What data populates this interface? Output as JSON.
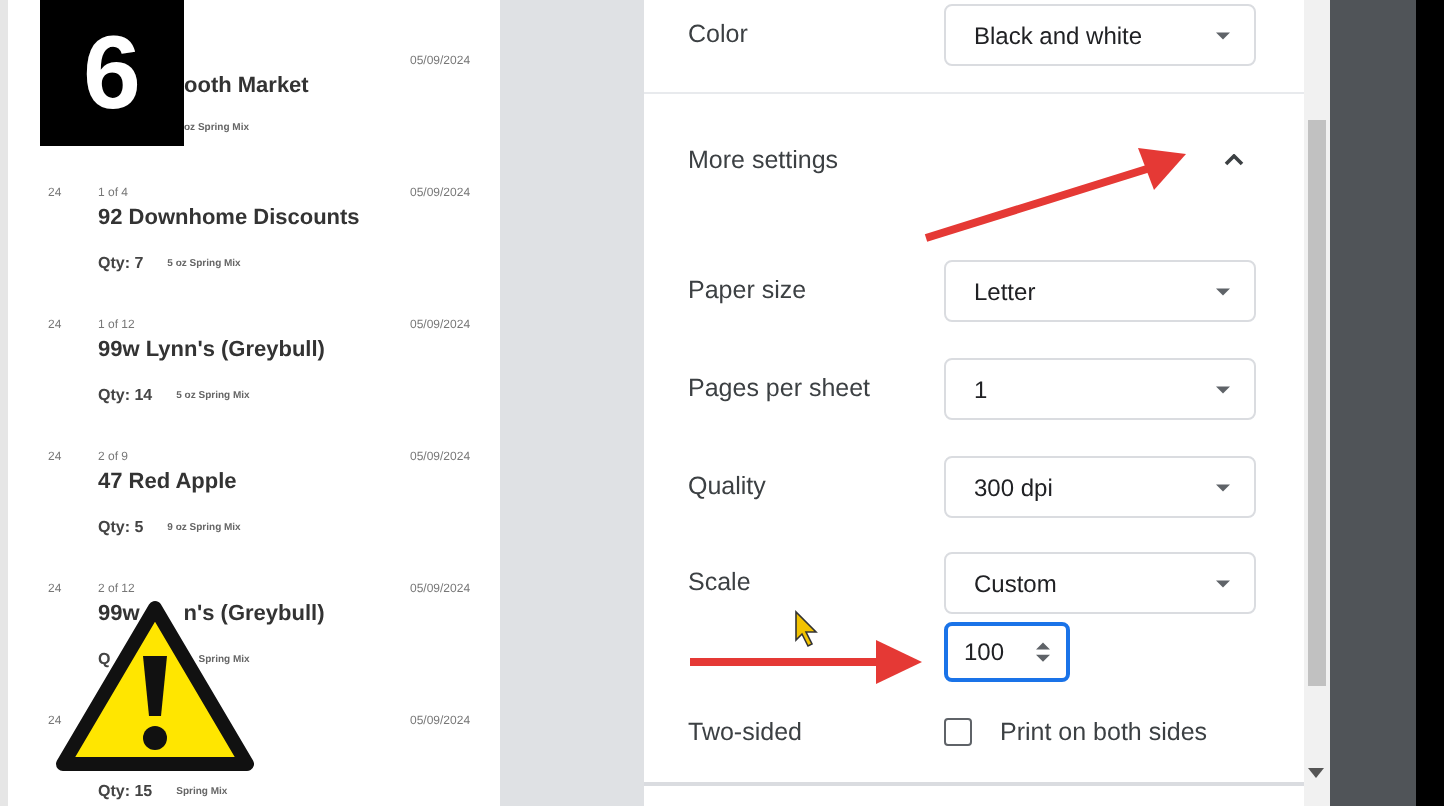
{
  "badge": {
    "text": "6"
  },
  "preview": {
    "entries": [
      {
        "kind": "covered",
        "date": "05/09/2024",
        "name": [
          "ooth Market"
        ],
        "product": [
          "oz Spring Mix"
        ]
      },
      {
        "kind": "plain",
        "number": "24",
        "count": "1 of 4",
        "date": "05/09/2024",
        "name": [
          "92 Downhome Discounts"
        ],
        "qty": [
          "Qty: 7"
        ],
        "product": [
          "5 oz Spring Mix"
        ]
      },
      {
        "kind": "plain",
        "number": "24",
        "count": "1 of 12",
        "date": "05/09/2024",
        "name": [
          "99w Lynn's (Greybull)"
        ],
        "qty": [
          "Qty: 14"
        ],
        "product": [
          "5 oz Spring Mix"
        ]
      },
      {
        "kind": "plain",
        "number": "24",
        "count": "2 of 9",
        "date": "05/09/2024",
        "name": [
          "47 Red Apple"
        ],
        "qty": [
          "Qty: 5"
        ],
        "product": [
          "9 oz Spring Mix"
        ]
      },
      {
        "kind": "covered",
        "number": "24",
        "count": "2 of 12",
        "date": "05/09/2024",
        "name": [
          "99w",
          "n's (Greybull)"
        ],
        "qty": [
          "Q"
        ],
        "product": [
          "Spring Mix"
        ]
      },
      {
        "kind": "plain",
        "number": "24",
        "date": "05/09/2024",
        "qty": [
          "Qty: 15"
        ],
        "product": [
          "Spring Mix"
        ]
      }
    ]
  },
  "settings": {
    "color": {
      "label": "Color",
      "value": "Black and white"
    },
    "more_settings": {
      "label": "More settings",
      "expanded": true
    },
    "rows": [
      {
        "kind": "select",
        "label": "Paper size",
        "value": "Letter"
      },
      {
        "kind": "select",
        "label": "Pages per sheet",
        "value": "1"
      },
      {
        "kind": "select",
        "label": "Quality",
        "value": "300 dpi"
      },
      {
        "kind": "select",
        "label": "Scale",
        "value": "Custom",
        "custom_value": "100",
        "focused": true
      },
      {
        "kind": "checkbox",
        "label": "Two-sided",
        "text": "Print on both sides",
        "checked": false
      }
    ]
  }
}
